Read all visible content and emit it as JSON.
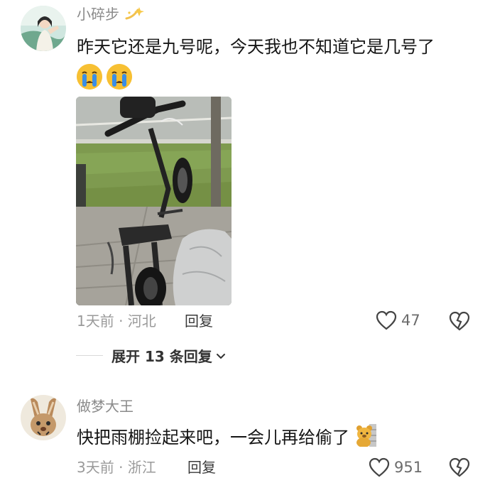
{
  "comments": [
    {
      "username": "小碎步",
      "text": "昨天它还是九号呢，今天我也不知道它是几号了",
      "meta": "1天前 · 河北",
      "reply_label": "回复",
      "likes": "47",
      "emojis": [
        "crying-face",
        "crying-face"
      ],
      "expand_label": "展开 13 条回复"
    },
    {
      "username": "做梦大王",
      "text": "快把雨棚捡起来吧，一会儿再给偷了",
      "meta": "3天前 · 浙江",
      "reply_label": "回复",
      "likes": "951",
      "sticker": "bear-sticker"
    }
  ],
  "colors": {
    "username": "#8a8a8a",
    "meta": "#9a9a9a",
    "text": "#151515",
    "emoji_yellow": "#f7c033",
    "tear_blue": "#3a8ee6"
  }
}
